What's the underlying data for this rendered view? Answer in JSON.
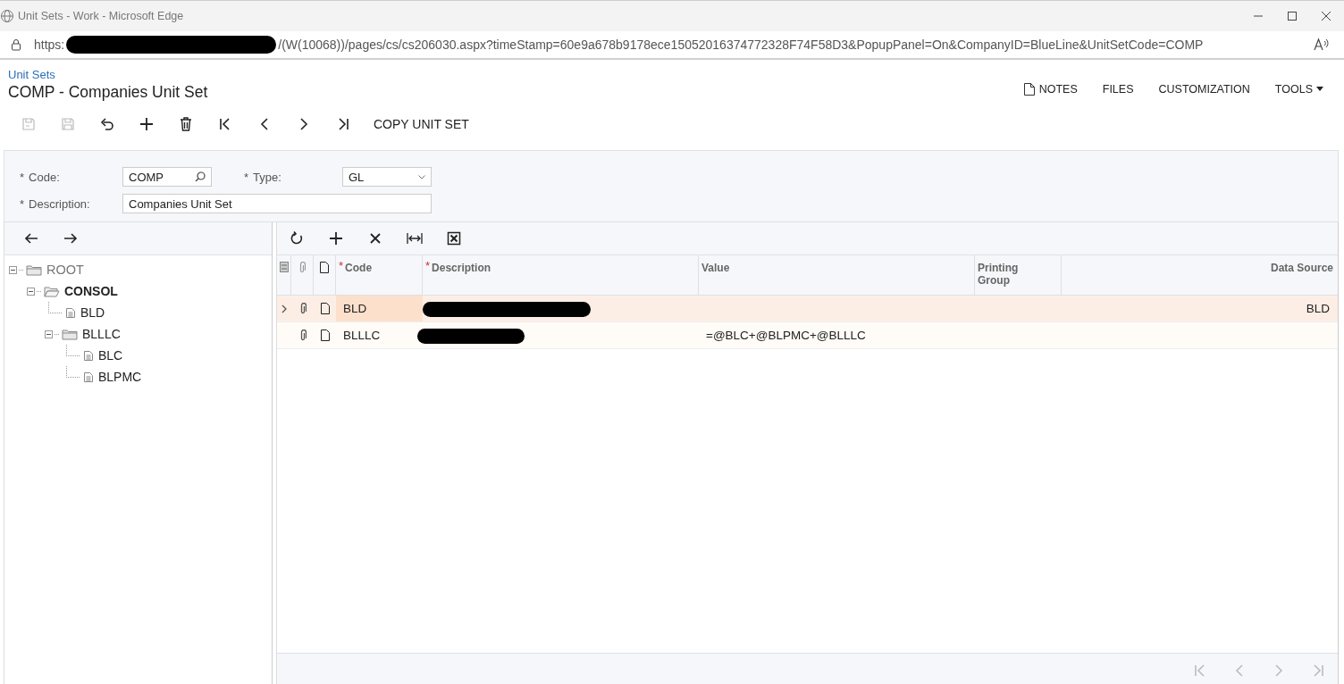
{
  "window": {
    "title": "Unit Sets - Work - Microsoft Edge"
  },
  "address_bar": {
    "url_start": "https:",
    "url_redacted": true,
    "url_end": "/(W(10068))/pages/cs/cs206030.aspx?timeStamp=60e9a678b9178ece15052016374772328F74F58D3&PopupPanel=On&CompanyID=BlueLine&UnitSetCode=COMP"
  },
  "breadcrumb": "Unit Sets",
  "page_title": "COMP - Companies Unit Set",
  "top_actions": [
    {
      "kind": "notes",
      "label": "NOTES"
    },
    {
      "kind": "plain",
      "label": "FILES"
    },
    {
      "kind": "plain",
      "label": "CUSTOMIZATION"
    },
    {
      "kind": "menu",
      "label": "TOOLS"
    }
  ],
  "toolbar": [
    {
      "kind": "save-close",
      "disabled": true
    },
    {
      "kind": "save",
      "disabled": true
    },
    {
      "kind": "undo",
      "disabled": false
    },
    {
      "kind": "add",
      "disabled": false
    },
    {
      "kind": "delete",
      "disabled": false
    },
    {
      "kind": "first",
      "disabled": false
    },
    {
      "kind": "prev",
      "disabled": false
    },
    {
      "kind": "next",
      "disabled": false
    },
    {
      "kind": "last",
      "disabled": false
    },
    {
      "kind": "text",
      "label": "COPY UNIT SET",
      "disabled": false
    }
  ],
  "form": {
    "fields": [
      {
        "kind": "lookup",
        "required_mark": "*",
        "label": "Code:",
        "value": "COMP"
      },
      {
        "kind": "select",
        "required_mark": "*",
        "label": "Type:",
        "value": "GL"
      },
      {
        "kind": "text",
        "required_mark": "*",
        "label": "Description:",
        "value": "Companies Unit Set"
      }
    ]
  },
  "tree": {
    "nav": [
      {
        "kind": "back"
      },
      {
        "kind": "forward"
      }
    ],
    "nodes": [
      {
        "label": "ROOT",
        "kind": "root",
        "expanded": true,
        "selected": false,
        "children": [
          {
            "label": "CONSOL",
            "kind": "folder",
            "expanded": true,
            "selected": true,
            "children": [
              {
                "label": "BLD",
                "kind": "leaf",
                "selected": false
              },
              {
                "label": "BLLLC",
                "kind": "folder",
                "expanded": true,
                "selected": false,
                "children": [
                  {
                    "label": "BLC",
                    "kind": "leaf",
                    "selected": false
                  },
                  {
                    "label": "BLPMC",
                    "kind": "leaf",
                    "selected": false
                  }
                ]
              }
            ]
          }
        ]
      }
    ]
  },
  "grid": {
    "toolbar": [
      {
        "kind": "refresh"
      },
      {
        "kind": "add"
      },
      {
        "kind": "delete"
      },
      {
        "kind": "fit"
      },
      {
        "kind": "excel"
      }
    ],
    "columns": [
      {
        "kind": "files"
      },
      {
        "kind": "attach"
      },
      {
        "kind": "note"
      },
      {
        "kind": "text",
        "required_mark": "*",
        "label": "Code"
      },
      {
        "kind": "text",
        "required_mark": "*",
        "label": "Description"
      },
      {
        "kind": "text",
        "label": "Value"
      },
      {
        "kind": "text",
        "label": "Printing Group"
      },
      {
        "kind": "text",
        "label": "Data Source"
      }
    ],
    "rows": [
      {
        "selected": true,
        "code": "BLD",
        "description_redacted": true,
        "value": "",
        "printing_group": "",
        "data_source": "BLD"
      },
      {
        "selected": false,
        "code": "BLLLC",
        "description_redacted": true,
        "value": "=@BLC+@BLPMC+@BLLLC",
        "printing_group": "",
        "data_source": ""
      }
    ],
    "pager": [
      {
        "kind": "first",
        "disabled": true
      },
      {
        "kind": "prev",
        "disabled": true
      },
      {
        "kind": "next",
        "disabled": true
      },
      {
        "kind": "last",
        "disabled": true
      }
    ]
  }
}
